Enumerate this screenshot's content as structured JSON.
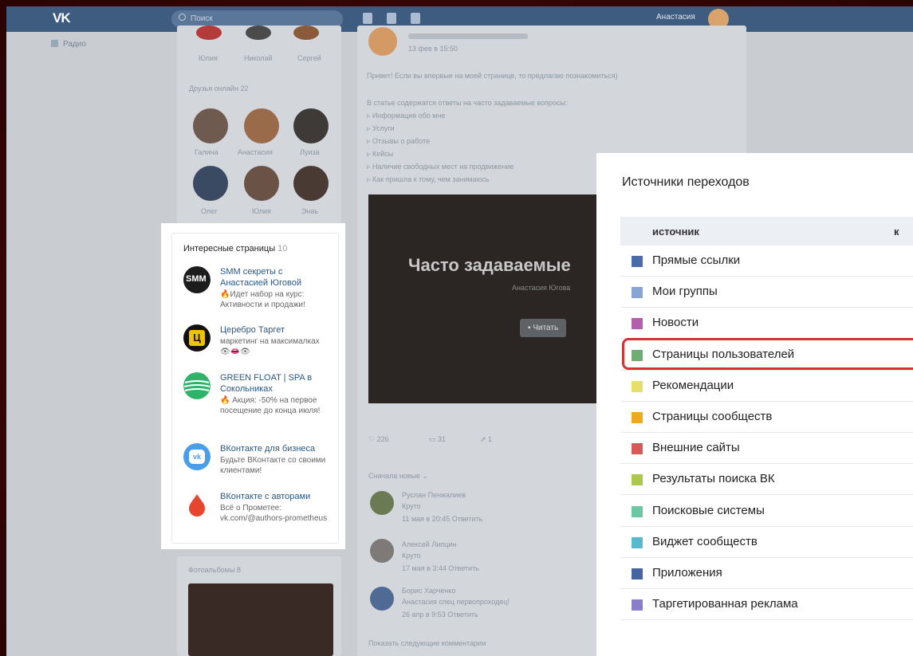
{
  "topbar": {
    "search_placeholder": "Поиск",
    "user_name": "Анастасия"
  },
  "left_nav": {
    "radio": "Радио"
  },
  "friends": {
    "top_names": [
      "Юлия",
      "Николай",
      "Сергей"
    ],
    "online_title": "Друзья онлайн",
    "online_count": "22",
    "row1": [
      "Галина",
      "Анастасия",
      "Луиза"
    ],
    "row2": [
      "Олег",
      "Юлия",
      "Энаь"
    ]
  },
  "photo_albums": {
    "title": "Фотоальбомы",
    "count": "8"
  },
  "post": {
    "date": "13 фев в 15:50",
    "intro": "Привет! Если вы впервые на моей странице, то предлагаю познакомиться)",
    "lead": "В статье содержатся ответы на часто задаваемые вопросы:",
    "bullets": [
      "Информация обо мне",
      "Услуги",
      "Отзывы о работе",
      "Кейсы",
      "Наличие свободных мест на продвижение",
      "Как пришла к тому, чем занимаюсь"
    ],
    "cover_title": "Часто задаваемые",
    "cover_sub": "Анастасия Югова",
    "read_button": "Читать",
    "likes": "226",
    "comments": "31",
    "shares": "1",
    "sort": "Сначала новые",
    "show_more": "Показать следующие комментарии"
  },
  "comments": [
    {
      "author": "Руслан Пенжалиев",
      "text": "Круто",
      "meta": "11 мая в 20:45",
      "reply": "Ответить"
    },
    {
      "author": "Алексей Липцин",
      "text": "Круто",
      "meta": "17 мая в 3:44",
      "reply": "Ответить"
    },
    {
      "author": "Борис Харченко",
      "text": "Анастасия спец первопроходец!",
      "meta": "26 апр в 9:53",
      "reply": "Ответить"
    }
  ],
  "interesting_pages": {
    "title": "Интересные страницы",
    "count": "10",
    "items": [
      {
        "name": "SMM секреты с Анастасией Юговой",
        "desc": "🔥Идет набор на курс: Активности и продажи!",
        "logo": "SMM"
      },
      {
        "name": "Церебро Таргет",
        "desc": "маркетинг на максималках 👁👄👁",
        "logo": "Ц"
      },
      {
        "name": "GREEN FLOAT | SPA в Сокольниках",
        "desc": "🔥 Акция: -50% на первое посещение до конца июля!",
        "logo": ""
      },
      {
        "name": "ВКонтакте для бизнеса",
        "desc": "Будьте ВКонтакте со своими клиентами!",
        "logo": "vk"
      },
      {
        "name": "ВКонтакте с авторами",
        "desc": "Всё о Прометее: vk.com/@authors-prometheus",
        "logo": ""
      }
    ]
  },
  "sources": {
    "title": "Источники переходов",
    "col_source": "источник",
    "col_count": "к",
    "rows": [
      {
        "label": "Прямые ссылки",
        "color": "#4a6da7"
      },
      {
        "label": "Мои группы",
        "color": "#87a6d4"
      },
      {
        "label": "Новости",
        "color": "#b35fae"
      },
      {
        "label": "Страницы пользователей",
        "color": "#6fae73"
      },
      {
        "label": "Рекомендации",
        "color": "#e6df6a"
      },
      {
        "label": "Страницы сообществ",
        "color": "#f0a91a"
      },
      {
        "label": "Внешние сайты",
        "color": "#d65a5a"
      },
      {
        "label": "Результаты поиска ВК",
        "color": "#abc94e"
      },
      {
        "label": "Поисковые системы",
        "color": "#6cc8a3"
      },
      {
        "label": "Виджет сообществ",
        "color": "#5ab8cf"
      },
      {
        "label": "Приложения",
        "color": "#4466a0"
      },
      {
        "label": "Таргетированная реклама",
        "color": "#8a7ec9"
      }
    ],
    "highlighted": "Страницы пользователей"
  }
}
